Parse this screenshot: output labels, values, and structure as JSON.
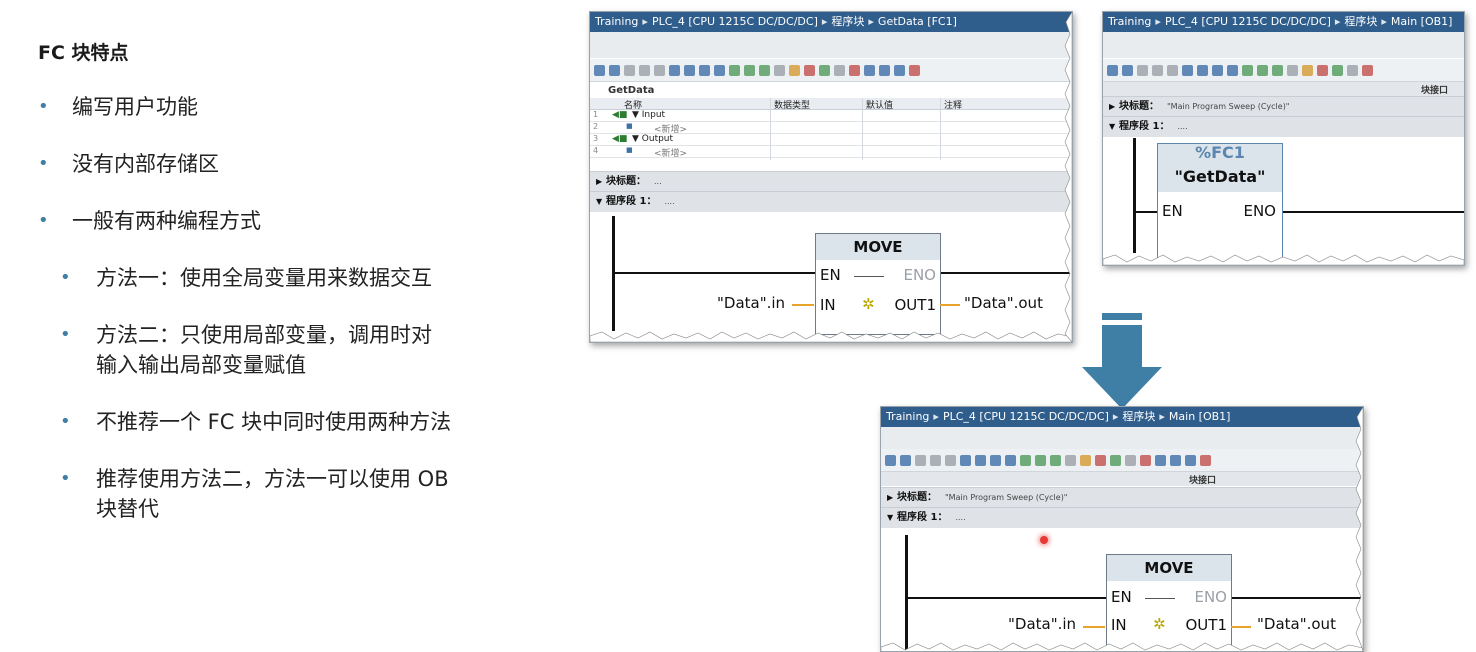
{
  "slide": {
    "title": "FC 块特点",
    "bullets": [
      {
        "level": 1,
        "text": "编写用户功能"
      },
      {
        "level": 1,
        "text": "没有内部存储区"
      },
      {
        "level": 1,
        "text": "一般有两种编程方式"
      },
      {
        "level": 2,
        "text": "方法一：使用全局变量用来数据交互"
      },
      {
        "level": 2,
        "text": "方法二：只使用局部变量，调用时对\n输入输出局部变量赋值"
      },
      {
        "level": 2,
        "text": "不推荐一个 FC 块中同时使用两种方法"
      },
      {
        "level": 2,
        "text": "推荐使用方法二，方法一可以使用 OB\n块替代"
      }
    ]
  },
  "win_fc1": {
    "breadcrumb": [
      "Training",
      "PLC_4 [CPU 1215C DC/DC/DC]",
      "程序块",
      "GetData [FC1]"
    ],
    "block_name": "GetData",
    "interface_columns": [
      "名称",
      "数据类型",
      "默认值",
      "注释"
    ],
    "interface_rows": [
      {
        "no": "1",
        "name": "▼ Input"
      },
      {
        "no": "2",
        "name": "<新增>"
      },
      {
        "no": "3",
        "name": "▼ Output"
      },
      {
        "no": "4",
        "name": "<新增>"
      }
    ],
    "block_title_label": "块标题：",
    "block_title_value": "...",
    "network_label": "程序段 1：",
    "network_comment": "....",
    "instruction": "MOVE",
    "pin_en": "EN",
    "pin_eno": "ENO",
    "pin_in": "IN",
    "pin_out": "OUT1",
    "operand_in": "\"Data\".in",
    "operand_out": "\"Data\".out"
  },
  "win_ob1_top": {
    "breadcrumb": [
      "Training",
      "PLC_4 [CPU 1215C DC/DC/DC]",
      "程序块",
      "Main [OB1]"
    ],
    "interface_tab": "块接口",
    "block_title_label": "块标题：",
    "block_title_value": "\"Main Program Sweep (Cycle)\"",
    "network_label": "程序段 1：",
    "network_comment": "....",
    "call_address": "%FC1",
    "call_name": "\"GetData\"",
    "pin_en": "EN",
    "pin_eno": "ENO"
  },
  "win_ob1_bottom": {
    "breadcrumb": [
      "Training",
      "PLC_4 [CPU 1215C DC/DC/DC]",
      "程序块",
      "Main [OB1]"
    ],
    "interface_tab": "块接口",
    "block_title_label": "块标题：",
    "block_title_value": "\"Main Program Sweep (Cycle)\"",
    "network_label": "程序段 1：",
    "network_comment": "....",
    "instruction": "MOVE",
    "pin_en": "EN",
    "pin_eno": "ENO",
    "pin_in": "IN",
    "pin_out": "OUT1",
    "operand_in": "\"Data\".in",
    "operand_out": "\"Data\".out"
  },
  "colors": {
    "titlebar": "#2f5d8c",
    "bullet": "#3f7fa6",
    "arrow": "#3f7fa6",
    "wire_assign": "#e8a32a"
  }
}
